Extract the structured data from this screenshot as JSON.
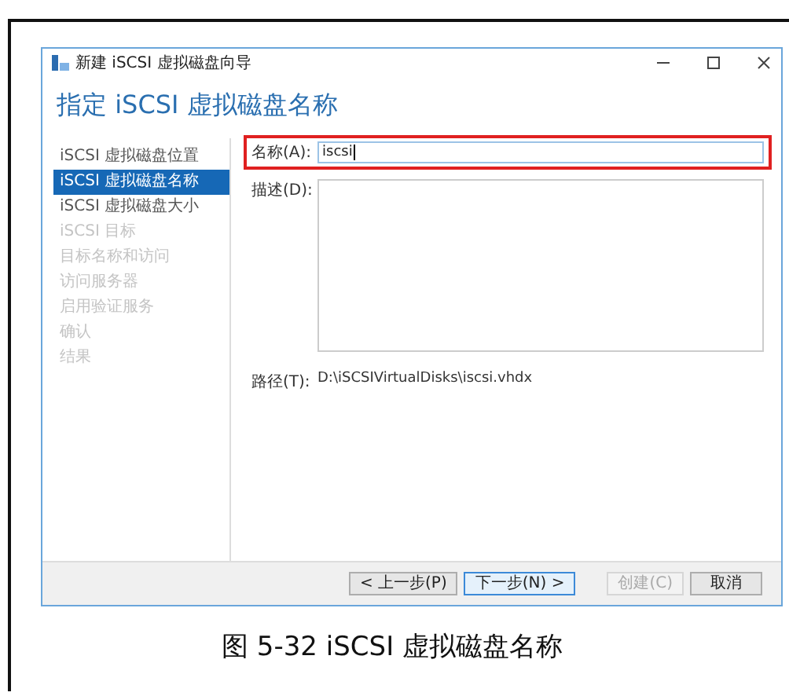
{
  "window": {
    "title": "新建 iSCSI 虚拟磁盘向导"
  },
  "heading": "指定 iSCSI 虚拟磁盘名称",
  "steps": [
    {
      "label": "iSCSI 虚拟磁盘位置",
      "selected": false,
      "disabled": false
    },
    {
      "label": "iSCSI 虚拟磁盘名称",
      "selected": true,
      "disabled": false
    },
    {
      "label": "iSCSI 虚拟磁盘大小",
      "selected": false,
      "disabled": false
    },
    {
      "label": "iSCSI 目标",
      "selected": false,
      "disabled": true
    },
    {
      "label": "目标名称和访问",
      "selected": false,
      "disabled": true
    },
    {
      "label": "访问服务器",
      "selected": false,
      "disabled": true
    },
    {
      "label": "启用验证服务",
      "selected": false,
      "disabled": true
    },
    {
      "label": "确认",
      "selected": false,
      "disabled": true
    },
    {
      "label": "结果",
      "selected": false,
      "disabled": true
    }
  ],
  "name_field": {
    "label": "名称(A):",
    "value": "iscsi",
    "highlighted": true
  },
  "description_field": {
    "label": "描述(D):"
  },
  "path": {
    "label": "路径(T):",
    "value": "D:\\iSCSIVirtualDisks\\iscsi.vhdx"
  },
  "buttons": [
    {
      "label": "< 上一步(P)",
      "disabled": false,
      "focused": false
    },
    {
      "label": "下一步(N) >",
      "disabled": false,
      "focused": true
    },
    {
      "label": "创建(C)",
      "disabled": true,
      "focused": false
    },
    {
      "label": "取消",
      "disabled": false,
      "focused": false
    }
  ],
  "caption": "图 5-32 iSCSI 虚拟磁盘名称"
}
